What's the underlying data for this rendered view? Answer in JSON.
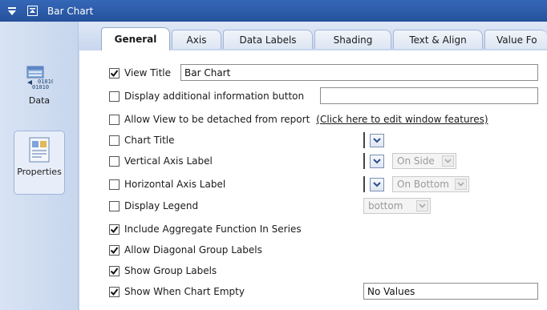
{
  "window": {
    "title": "Bar Chart"
  },
  "sidebar": {
    "items": [
      {
        "label": "Data",
        "icon": "data-binary-icon"
      },
      {
        "label": "Properties",
        "icon": "properties-icon"
      }
    ]
  },
  "tabs": [
    {
      "label": "General",
      "active": true
    },
    {
      "label": "Axis"
    },
    {
      "label": "Data Labels"
    },
    {
      "label": "Shading"
    },
    {
      "label": "Text & Align"
    },
    {
      "label": "Value Fo"
    }
  ],
  "general": {
    "view_title": {
      "label": "View Title",
      "checked": true,
      "value": "Bar Chart"
    },
    "display_info_button": {
      "label": "Display additional information button",
      "checked": false,
      "value": ""
    },
    "allow_detach": {
      "label": "Allow View to be detached from report",
      "checked": false,
      "link": "(Click here to edit window features)"
    },
    "chart_title": {
      "label": "Chart Title",
      "checked": false
    },
    "vertical_axis_label": {
      "label": "Vertical Axis Label",
      "checked": false,
      "position": "On Side"
    },
    "horizontal_axis_label": {
      "label": "Horizontal Axis Label",
      "checked": false,
      "position": "On Bottom"
    },
    "display_legend": {
      "label": "Display Legend",
      "checked": false,
      "position": "bottom"
    },
    "include_aggregate": {
      "label": "Include Aggregate Function In Series",
      "checked": true
    },
    "allow_diagonal": {
      "label": "Allow Diagonal Group Labels",
      "checked": true
    },
    "show_group_labels": {
      "label": "Show Group Labels",
      "checked": true
    },
    "show_when_empty": {
      "label": "Show When Chart Empty",
      "checked": true,
      "value": "No Values"
    }
  },
  "colors": {
    "titlebar": "#2f5fae",
    "panel": "#d0dcf1",
    "accent": "#3567b8"
  }
}
